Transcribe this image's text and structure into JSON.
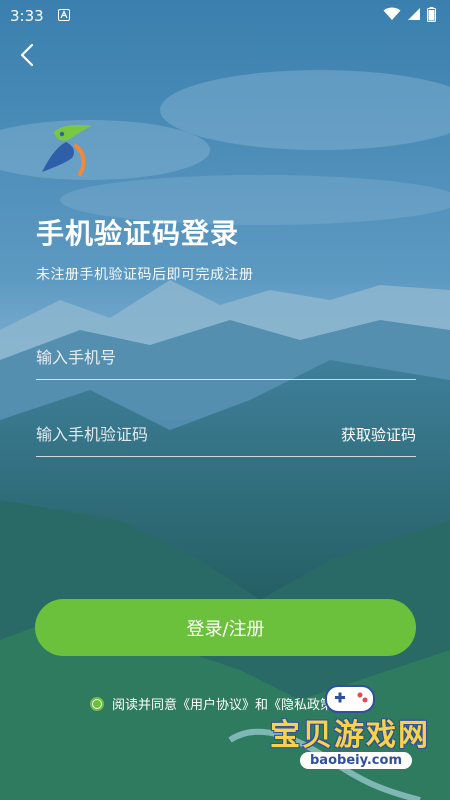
{
  "status_bar": {
    "time": "3:33",
    "notification_icon": "a-box-icon",
    "wifi_icon": "wifi-icon",
    "signal_icon": "signal-icon",
    "battery_icon": "battery-icon"
  },
  "header": {
    "back_icon": "chevron-left-icon",
    "logo_icon": "bird-logo-icon"
  },
  "login": {
    "title": "手机验证码登录",
    "subtitle": "未注册手机验证码后即可完成注册",
    "phone_placeholder": "输入手机号",
    "phone_value": "",
    "code_placeholder": "输入手机验证码",
    "code_value": "",
    "get_code_label": "获取验证码",
    "submit_label": "登录/注册"
  },
  "agreement": {
    "checked": true,
    "prefix": "阅读并同意",
    "user_agreement": "《用户协议》",
    "conjunction": "和",
    "privacy_policy": "《隐私政策》"
  },
  "watermark": {
    "text": "宝贝游戏网",
    "url": "baobeiy.com"
  },
  "colors": {
    "accent": "#6cc13c",
    "background": "#2f6f9a",
    "text": "#ffffff"
  }
}
